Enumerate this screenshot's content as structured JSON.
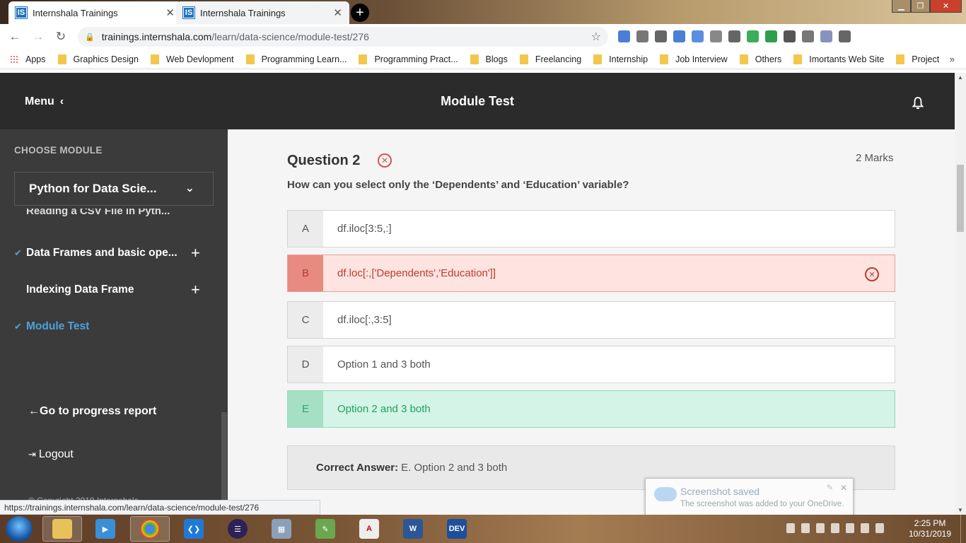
{
  "browser": {
    "tabs": [
      {
        "title": "Internshala Trainings",
        "favicon": "IS"
      },
      {
        "title": "Internshala Trainings",
        "favicon": "IS"
      }
    ],
    "url_host": "trainings.internshala.com",
    "url_path": "/learn/data-science/module-test/276",
    "bookmarks": [
      "Apps",
      "Graphics Design",
      "Web Devlopment",
      "Programming Learn...",
      "Programming Pract...",
      "Blogs",
      "Freelancing",
      "Internship",
      "Job Interview",
      "Others",
      "Imortants Web Site",
      "Project"
    ],
    "status_url": "https://trainings.internshala.com/learn/data-science/module-test/276"
  },
  "header": {
    "menu_label": "Menu",
    "title": "Module Test"
  },
  "sidebar": {
    "choose_label": "CHOOSE MODULE",
    "selected_module": "Python for Data Scie...",
    "cut_item": "Reading a CSV File in Pyth...",
    "items": [
      {
        "label": "Data Frames and basic ope...",
        "checked": true
      },
      {
        "label": "Indexing Data Frame",
        "checked": false
      },
      {
        "label": "Module Test",
        "checked": true
      }
    ],
    "progress_link": "Go to progress report",
    "logout": "Logout",
    "copyright": "© Copyright 2019 Internshala"
  },
  "question": {
    "title": "Question 2",
    "marks": "2 Marks",
    "text": "How can you select only the ‘Dependents’ and ‘Education’ variable?",
    "options": [
      {
        "key": "A",
        "text": "df.iloc[3:5,:]",
        "state": "neutral"
      },
      {
        "key": "B",
        "text": "df.loc[:,['Dependents','Education']]",
        "state": "wrong"
      },
      {
        "key": "C",
        "text": "df.iloc[:,3:5]",
        "state": "neutral"
      },
      {
        "key": "D",
        "text": "Option 1 and 3 both",
        "state": "neutral"
      },
      {
        "key": "E",
        "text": "Option 2 and 3 both",
        "state": "correct"
      }
    ],
    "correct_label": "Correct Answer:",
    "correct_value": "E. Option 2 and 3 both"
  },
  "toast": {
    "title": "Screenshot saved",
    "body": "The screenshot was added to your OneDrive."
  },
  "taskbar": {
    "time": "2:25 PM",
    "date": "10/31/2019"
  },
  "colors": {
    "wrong": "#c0392b",
    "correct": "#1fa35b",
    "accent": "#4aa3df",
    "header_bg": "#2b2b2b",
    "sidebar_bg": "#3b3b3b"
  }
}
